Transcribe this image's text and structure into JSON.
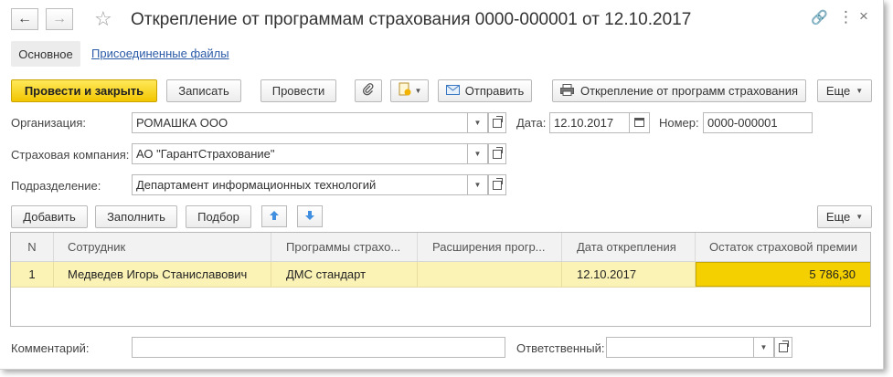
{
  "window": {
    "title": "Открепление от программам страхования 0000-000001 от 12.10.2017",
    "back_icon": "arrow-left-icon",
    "forward_icon": "arrow-right-icon",
    "favorite_icon": "star-icon",
    "link_icon": "link-icon",
    "menu_icon": "more-vertical-icon",
    "close_icon": "close-icon"
  },
  "tabs": {
    "main": "Основное",
    "files": "Присоединенные файлы"
  },
  "toolbar": {
    "post_close": "Провести и закрыть",
    "save": "Записать",
    "post": "Провести",
    "attach_icon": "paperclip-icon",
    "create_based_icon": "document-add-icon",
    "send": "Отправить",
    "print": "Открепление от программ страхования",
    "more": "Еще"
  },
  "form": {
    "org_label": "Организация:",
    "org_value": "РОМАШКА ООО",
    "date_label": "Дата:",
    "date_value": "12.10.2017",
    "number_label": "Номер:",
    "number_value": "0000-000001",
    "insurer_label": "Страховая компания:",
    "insurer_value": "АО \"ГарантСтрахование\"",
    "dept_label": "Подразделение:",
    "dept_value": "Департамент информационных технологий",
    "comment_label": "Комментарий:",
    "comment_value": "",
    "responsible_label": "Ответственный:",
    "responsible_value": ""
  },
  "table_toolbar": {
    "add": "Добавить",
    "fill": "Заполнить",
    "select": "Подбор",
    "up_icon": "arrow-up-icon",
    "down_icon": "arrow-down-icon",
    "more": "Еще"
  },
  "table": {
    "columns": [
      "N",
      "Сотрудник",
      "Программы страхо...",
      "Расширения прогр...",
      "Дата открепления",
      "Остаток страховой премии"
    ],
    "rows": [
      {
        "n": "1",
        "employee": "Медведев Игорь Станиславович",
        "program": "ДМС стандарт",
        "extensions": "",
        "date": "12.10.2017",
        "remainder": "5 786,30"
      }
    ]
  },
  "colors": {
    "primary_button": "#f2c500",
    "selected_row": "#fbf3b5",
    "selected_cell": "#f5d000",
    "link": "#2b5aa8"
  }
}
